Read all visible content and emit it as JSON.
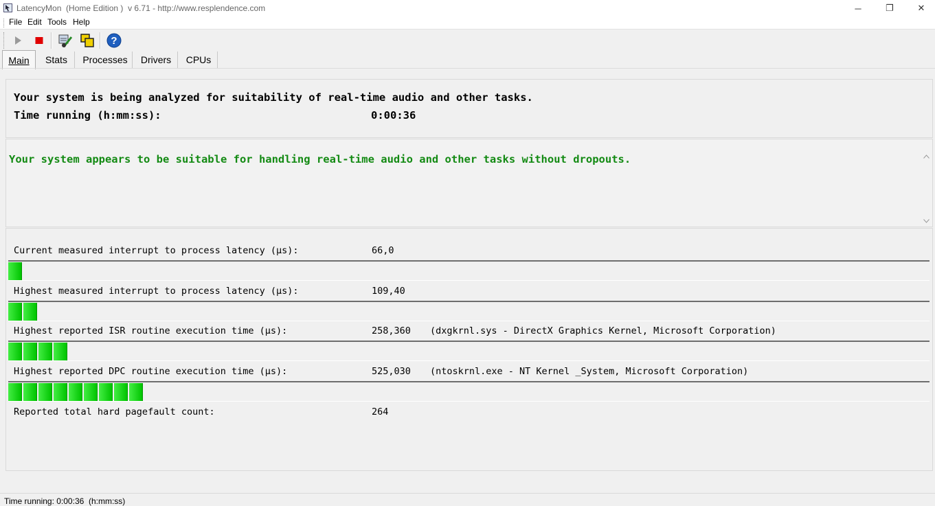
{
  "window": {
    "title": "LatencyMon  (Home Edition )  v 6.71 - http://www.resplendence.com",
    "min_glyph": "─",
    "max_glyph": "❐",
    "close_glyph": "✕"
  },
  "menu": {
    "items": [
      {
        "label": "File"
      },
      {
        "label": "Edit"
      },
      {
        "label": "Tools"
      },
      {
        "label": "Help"
      }
    ]
  },
  "toolbar": {
    "buttons": [
      "play-icon",
      "stop-icon",
      "drivers-icon",
      "windows-icon",
      "help-icon"
    ],
    "colors": {
      "stop": "#e00000",
      "play": "#9a9a9a",
      "help": "#1f5fbf"
    }
  },
  "tabs": [
    {
      "label": "Main",
      "active": true
    },
    {
      "label": "Stats",
      "active": false
    },
    {
      "label": "Processes",
      "active": false
    },
    {
      "label": "Drivers",
      "active": false
    },
    {
      "label": "CPUs",
      "active": false
    }
  ],
  "status_panel": {
    "analyzing_text": "Your system is being analyzed for suitability of real-time audio and other tasks.",
    "time_label": "Time running (h:mm:ss):",
    "time_value": "0:00:36"
  },
  "verdict": {
    "text": "Your system appears to be suitable for handling real-time audio and other tasks without dropouts.",
    "color": "#138a13"
  },
  "metrics": [
    {
      "label": "Current measured interrupt to process latency (µs):",
      "value": "66,0",
      "detail": "",
      "bar_segments": 1
    },
    {
      "label": "Highest measured interrupt to process latency (µs):",
      "value": "109,40",
      "detail": "",
      "bar_segments": 2
    },
    {
      "label": "Highest reported ISR routine execution time (µs):",
      "value": "258,360",
      "detail": "(dxgkrnl.sys - DirectX Graphics Kernel, Microsoft Corporation)",
      "bar_segments": 4
    },
    {
      "label": "Highest reported DPC routine execution time (µs):",
      "value": "525,030",
      "detail": "(ntoskrnl.exe - NT Kernel _System, Microsoft Corporation)",
      "bar_segments": 9
    },
    {
      "label": "Reported total hard pagefault count:",
      "value": "264",
      "detail": ""
    }
  ],
  "statusbar": {
    "text": "Time running: 0:00:36  (h:mm:ss)"
  }
}
